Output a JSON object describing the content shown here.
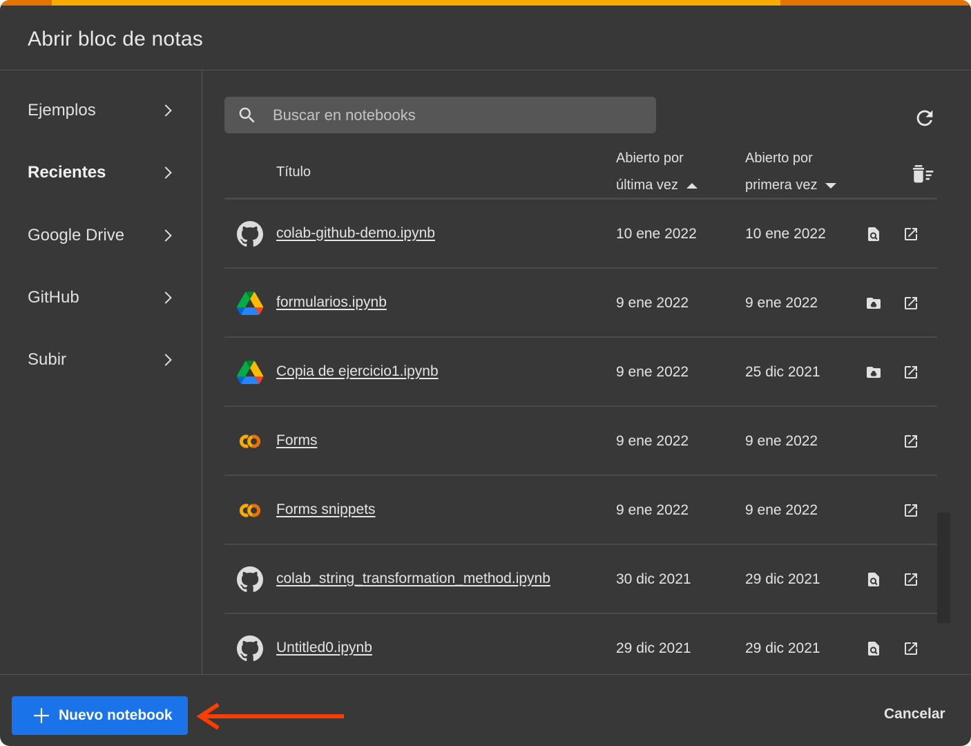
{
  "dialog": {
    "title": "Abrir bloc de notas"
  },
  "colors": {
    "accent": "#f9ab00",
    "primary_button": "#1a73e8",
    "annotation_arrow": "#ff3d00",
    "background": "#383838"
  },
  "sidebar": {
    "items": [
      {
        "label": "Ejemplos",
        "active": false
      },
      {
        "label": "Recientes",
        "active": true
      },
      {
        "label": "Google Drive",
        "active": false
      },
      {
        "label": "GitHub",
        "active": false
      },
      {
        "label": "Subir",
        "active": false
      }
    ]
  },
  "search": {
    "placeholder": "Buscar en notebooks",
    "value": ""
  },
  "table": {
    "columns": {
      "title": "Título",
      "last_opened_line1": "Abierto por",
      "last_opened_line2": "última vez",
      "first_opened_line1": "Abierto por",
      "first_opened_line2": "primera vez"
    },
    "rows": [
      {
        "source": "github-icon",
        "name": "colab-github-demo.ipynb",
        "last": "10 ene 2022",
        "first": "10 ene 2022",
        "action1": "view-source-icon"
      },
      {
        "source": "google-drive-icon",
        "name": "formularios.ipynb",
        "last": "9 ene 2022",
        "first": "9 ene 2022",
        "action1": "drive-folder-icon"
      },
      {
        "source": "google-drive-icon",
        "name": "Copia de ejercicio1.ipynb",
        "last": "9 ene 2022",
        "first": "25 dic 2021",
        "action1": "drive-folder-icon"
      },
      {
        "source": "colab-icon",
        "name": "Forms",
        "last": "9 ene 2022",
        "first": "9 ene 2022",
        "action1": ""
      },
      {
        "source": "colab-icon",
        "name": "Forms snippets",
        "last": "9 ene 2022",
        "first": "9 ene 2022",
        "action1": ""
      },
      {
        "source": "github-icon",
        "name": "colab_string_transformation_method.ipynb",
        "last": "30 dic 2021",
        "first": "29 dic 2021",
        "action1": "view-source-icon"
      },
      {
        "source": "github-icon",
        "name": "Untitled0.ipynb",
        "last": "29 dic 2021",
        "first": "29 dic 2021",
        "action1": "view-source-icon"
      }
    ]
  },
  "footer": {
    "new_notebook": "Nuevo notebook",
    "cancel": "Cancelar"
  }
}
